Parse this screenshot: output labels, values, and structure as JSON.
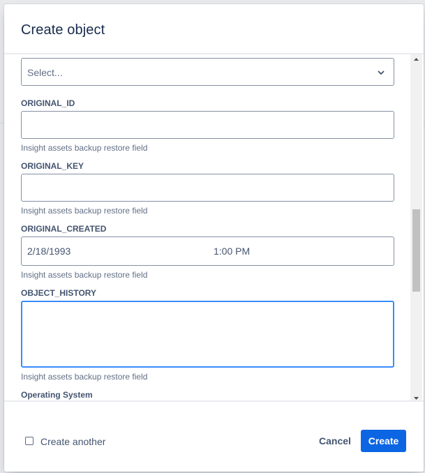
{
  "modal": {
    "title": "Create object"
  },
  "form": {
    "partial_field": {
      "placeholder": "Select..."
    },
    "fields": [
      {
        "label": "ORIGINAL_ID",
        "value": "",
        "help": "Insight assets backup restore field"
      },
      {
        "label": "ORIGINAL_KEY",
        "value": "",
        "help": "Insight assets backup restore field"
      },
      {
        "label": "ORIGINAL_CREATED",
        "date": "2/18/1993",
        "time": "1:00 PM",
        "help": "Insight assets backup restore field"
      },
      {
        "label": "OBJECT_HISTORY",
        "value": "",
        "help": "Insight assets backup restore field"
      },
      {
        "label": "Operating System"
      }
    ]
  },
  "footer": {
    "create_another_label": "Create another",
    "create_another_checked": false,
    "cancel_label": "Cancel",
    "create_label": "Create"
  },
  "colors": {
    "primary": "#0c66e4",
    "focus_border": "#388bff"
  }
}
